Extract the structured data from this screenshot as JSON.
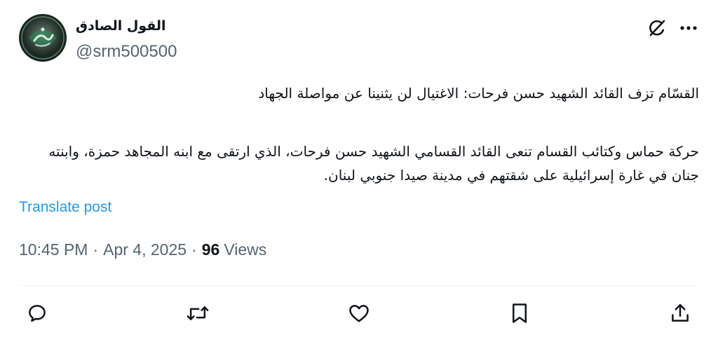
{
  "author": {
    "display_name": "القول الصادق",
    "handle": "@srm500500",
    "avatar_icon": "green-emblem-avatar"
  },
  "header_actions": {
    "grok_icon": "grok-icon",
    "more_icon": "more-icon"
  },
  "tweet": {
    "paragraphs": [
      "القسّام تزف القائد الشهيد حسن فرحات: الاغتيال لن يثنينا عن مواصلة الجهاد",
      "حركة حماس وكتائب القسام تنعى القائد القسامي الشهيد حسن فرحات، الذي ارتقى مع ابنه المجاهد حمزة، وابنته جنان في غارة إسرائيلية على شقتهم في مدينة صيدا جنوبي لبنان."
    ],
    "translate_label": "Translate post"
  },
  "meta": {
    "time": "10:45 PM",
    "separator": "·",
    "date": "Apr 4, 2025",
    "views_count": "96",
    "views_label": "Views"
  },
  "actions": {
    "reply_icon": "reply-icon",
    "retweet_icon": "retweet-icon",
    "like_icon": "heart-icon",
    "bookmark_icon": "bookmark-icon",
    "share_icon": "share-icon"
  },
  "colors": {
    "text": "#0f1419",
    "muted": "#536471",
    "link": "#1d9bf0",
    "divider": "#eff3f4",
    "background": "#ffffff"
  }
}
